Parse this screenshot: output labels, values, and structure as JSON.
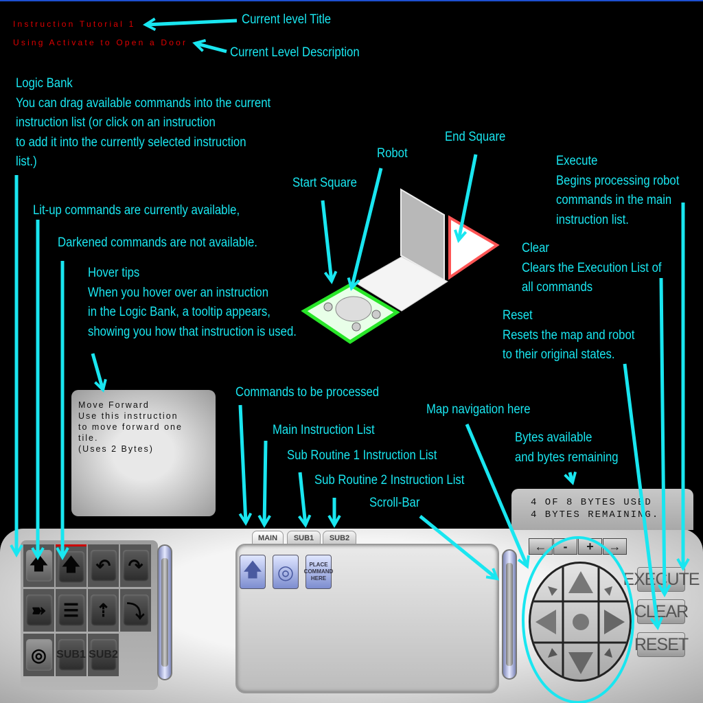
{
  "level": {
    "title": "Instruction Tutorial 1",
    "description": "Using Activate to Open a Door"
  },
  "annotations": {
    "level_title": "Current level Title",
    "level_description": "Current Level Description",
    "logic_bank": [
      "Logic Bank",
      "You can drag available commands into the current",
      "instruction list (or click on an instruction",
      "to add  it into the currently selected instruction",
      "list.)"
    ],
    "lit_up": "Lit-up commands are currently available,",
    "darkened": "Darkened commands are not available.",
    "hover_tips": [
      "Hover tips",
      "When you hover over an instruction",
      "in the Logic Bank, a tooltip appears,",
      "showing you how that instruction is used."
    ],
    "start_square": "Start Square",
    "robot": "Robot",
    "end_square": "End Square",
    "execute": [
      "Execute",
      "Begins processing robot",
      "commands in the main",
      "instruction list."
    ],
    "clear": [
      "Clear",
      "Clears the Execution List of",
      "all commands"
    ],
    "reset": [
      "Reset",
      "Resets the map and robot",
      "to their original states."
    ],
    "commands": "Commands to be processed",
    "map_nav": "Map navigation here",
    "main_list": "Main Instruction List",
    "sub1_list": "Sub Routine 1 Instruction List",
    "sub2_list": "Sub Routine 2 Instruction List",
    "scroll_bar": "Scroll-Bar",
    "bytes": [
      "Bytes available",
      "and bytes remaining"
    ]
  },
  "tooltip": [
    "Move Forward",
    "Use this instruction",
    "to move forward one",
    "tile.",
    "(Uses 2 Bytes)"
  ],
  "logic_bank": [
    {
      "icon": "move-forward-icon",
      "glyph": "🡅",
      "lit": true
    },
    {
      "icon": "jump-forward-icon",
      "glyph": "🡅",
      "lit": false
    },
    {
      "icon": "turn-left-icon",
      "glyph": "↶",
      "lit": false
    },
    {
      "icon": "turn-right-icon",
      "glyph": "↷",
      "lit": false
    },
    {
      "icon": "fire-icon",
      "glyph": "➽",
      "lit": false
    },
    {
      "icon": "ladder-icon",
      "glyph": "☰",
      "lit": false
    },
    {
      "icon": "climb-icon",
      "glyph": "⇡",
      "lit": false
    },
    {
      "icon": "drop-icon",
      "glyph": "⤵",
      "lit": false
    },
    {
      "icon": "activate-icon",
      "glyph": "◎",
      "lit": true
    },
    {
      "icon": "sub1-icon",
      "glyph": "SUB1",
      "lit": false
    },
    {
      "icon": "sub2-icon",
      "glyph": "SUB2",
      "lit": false
    }
  ],
  "tabs": [
    "MAIN",
    "SUB1",
    "SUB2"
  ],
  "main_list": [
    {
      "icon": "move-forward-icon",
      "glyph": "🡅"
    },
    {
      "icon": "activate-icon",
      "glyph": "◎"
    },
    {
      "icon": "placeholder",
      "label": "PLACE COMMAND HERE"
    }
  ],
  "bytes_display": {
    "used": "4 OF 8 BYTES USED",
    "remaining": "4 BYTES REMAINING."
  },
  "nav_buttons": [
    "←",
    "-",
    "+",
    "→"
  ],
  "actions": {
    "execute": "EXECUTE",
    "clear": "CLEAR",
    "reset": "RESET"
  },
  "colors": {
    "annotation": "#19e6f0",
    "level_text": "#e00000",
    "start": "#2ee82e",
    "end": "#ff5a5a"
  }
}
